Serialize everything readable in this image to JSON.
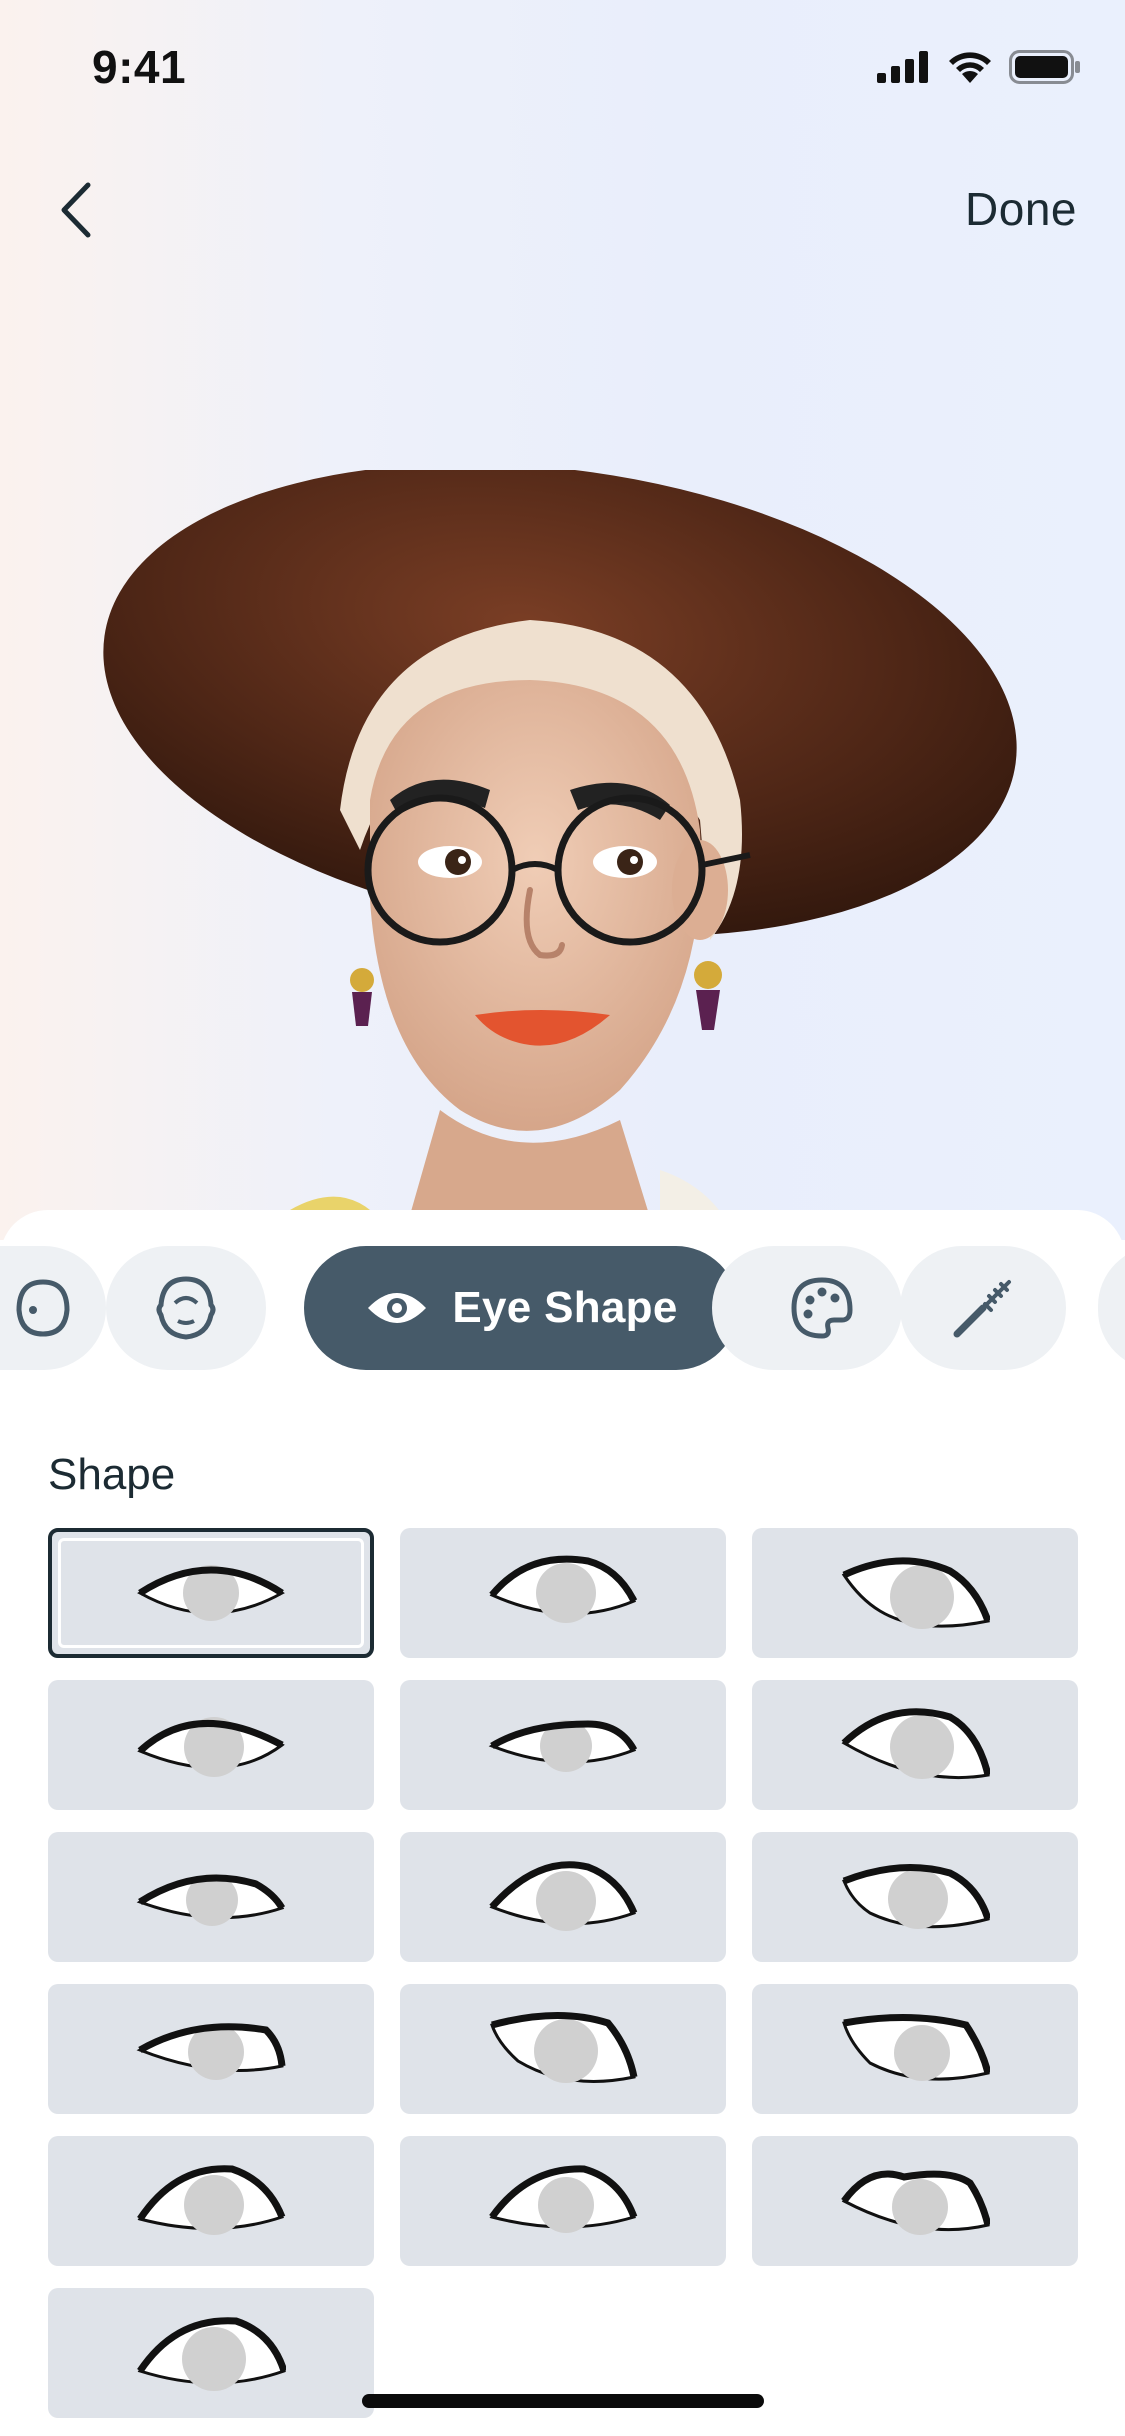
{
  "status_bar": {
    "time": "9:41",
    "icons": [
      "cellular-signal-icon",
      "wifi-icon",
      "battery-icon"
    ]
  },
  "nav": {
    "back_icon": "chevron-left-icon",
    "done_label": "Done"
  },
  "avatar": {
    "description_icon": "avatar-3d-preview"
  },
  "category_tabs": [
    {
      "name": "face-shape",
      "icon": "face-outline-icon",
      "label": "",
      "active": false
    },
    {
      "name": "head",
      "icon": "head-outline-icon",
      "label": "",
      "active": false
    },
    {
      "name": "eye-shape",
      "icon": "eye-icon",
      "label": "Eye Shape",
      "active": true
    },
    {
      "name": "eye-color",
      "icon": "palette-icon",
      "label": "",
      "active": false
    },
    {
      "name": "eye-makeup",
      "icon": "mascara-wand-icon",
      "label": "",
      "active": false
    }
  ],
  "section": {
    "label": "Shape"
  },
  "shape_options": {
    "selected_index": 0,
    "count": 16
  },
  "colors": {
    "active_tab": "#465a69",
    "tile_bg": "#dfe3e9",
    "selected_border": "#1c2b33",
    "pupil": "#d0d0d0"
  }
}
